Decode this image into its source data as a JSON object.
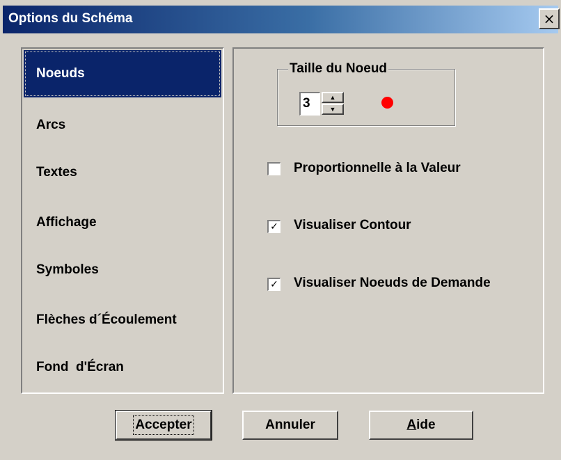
{
  "window": {
    "title": "Options du Schéma",
    "close_symbol": "×",
    "close_icon": "close-icon"
  },
  "nav": {
    "selected_index": 0,
    "items": [
      {
        "label": "Noeuds"
      },
      {
        "label": "Arcs"
      },
      {
        "label": "Textes"
      },
      {
        "label": "Affichage"
      },
      {
        "label": "Symboles"
      },
      {
        "label": "Flèches d´Écoulement"
      },
      {
        "label": "Fond  d'Écran"
      }
    ]
  },
  "node_size": {
    "legend": "Taille du Noeud",
    "value": "3",
    "dot_color": "#ff0000"
  },
  "options": {
    "proportional": {
      "label": "Proportionnelle à la Valeur",
      "checked": false
    },
    "show_outline": {
      "label": "Visualiser Contour",
      "checked": true
    },
    "show_demand_nodes": {
      "label": "Visualiser Noeuds de Demande",
      "checked": true
    }
  },
  "buttons": {
    "accept": "Accepter",
    "cancel": "Annuler",
    "help_first": "A",
    "help_rest": "ide"
  },
  "colors": {
    "selection": "#0a246a",
    "face": "#d4d0c8"
  }
}
